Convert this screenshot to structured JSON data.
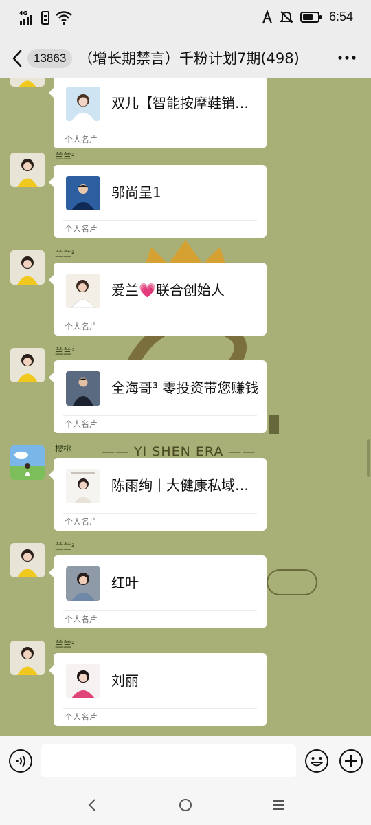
{
  "status_bar": {
    "network": "4G",
    "time": "6:54",
    "icons": [
      "signal-icon",
      "sim-icon",
      "wifi-icon",
      "alarm-icon",
      "mute-icon",
      "battery-icon"
    ]
  },
  "nav": {
    "unread_count": "13863",
    "title": "（增长期禁言）千粉计划7期(498)"
  },
  "watermark": {
    "brand_en": "—— YI SHEN ERA ——"
  },
  "messages": [
    {
      "sender": "",
      "card_name": "双儿【智能按摩鞋销售】",
      "card_type": "个人名片"
    },
    {
      "sender": "兰兰²",
      "card_name": "邬尚呈1",
      "card_type": "个人名片"
    },
    {
      "sender": "兰兰²",
      "card_name": "爱兰💗联合创始人",
      "card_type": "个人名片"
    },
    {
      "sender": "兰兰²",
      "card_name": "全海哥³ 零投资带您赚钱",
      "card_type": "个人名片"
    },
    {
      "sender": "樱桃",
      "card_name": "陈雨绚丨大健康私域创业",
      "card_type": "个人名片"
    },
    {
      "sender": "兰兰²",
      "card_name": "红叶",
      "card_type": "个人名片"
    },
    {
      "sender": "兰兰²",
      "card_name": "刘丽",
      "card_type": "个人名片"
    }
  ],
  "input": {
    "value": "",
    "placeholder": ""
  },
  "colors": {
    "chat_background": "#a8b078",
    "bar_background": "#ededed",
    "watermark": "#4a4a22",
    "crown": "#d9a02a"
  }
}
